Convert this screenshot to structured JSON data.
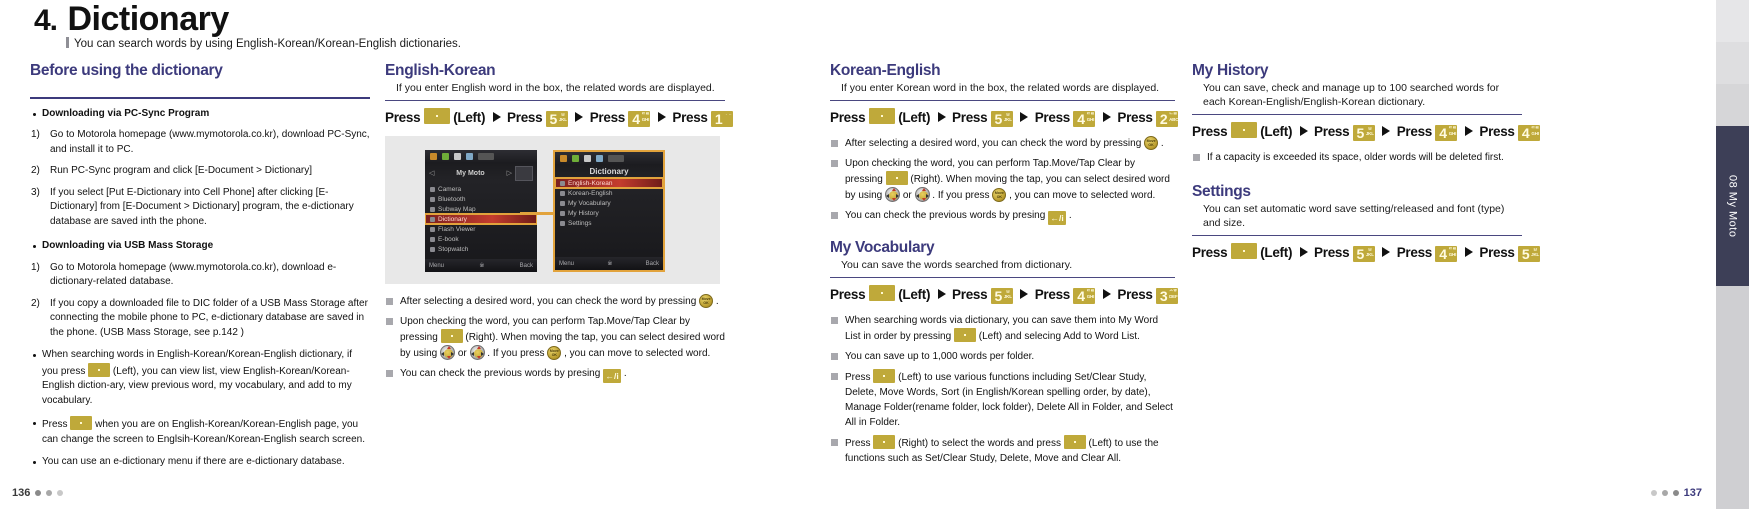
{
  "header": {
    "number": "4.",
    "title": "Dictionary",
    "subtitle": "You can search words by using English-Korean/Korean-English dictionaries."
  },
  "edge_tab": {
    "label": "08 My Moto"
  },
  "footer": {
    "page_left": "136",
    "page_right": "137"
  },
  "col1": {
    "title": "Before using the dictionary",
    "bullet_pcsync": "Downloading via PC-Sync Program",
    "steps_pcsync": [
      {
        "n": "1)",
        "text": "Go to Motorola homepage (www.mymotorola.co.kr), download PC-Sync, and install it to PC."
      },
      {
        "n": "2)",
        "text": "Run PC-Sync program and click [E-Document > Dictionary]"
      },
      {
        "n": "3)",
        "text": "If you select [Put E-Dictionary into Cell Phone] after clicking [E-Dictionary] from [E-Document > Dictionary] program, the e-dictionary database are saved inth the phone."
      }
    ],
    "bullet_usb": "Downloading via USB Mass Storage",
    "steps_usb": [
      {
        "n": "1)",
        "text": "Go to Motorola homepage (www.mymotorola.co.kr), download e-dictionary-related database."
      },
      {
        "n": "2)",
        "text": "If you copy a downloaded file to DIC folder of a USB Mass Storage after connecting the mobile phone to PC, e-dictionary database are saved in the phone. (USB Mass Storage, see p.142 )"
      }
    ],
    "notes": [
      {
        "pre": "When searching words in English-Korean/Korean-English dictionary, if you press",
        "post": "(Left), you can view list, view English-Korean/Korean-English diction-ary, view previous word, my vocabulary, and add to my vocabulary."
      },
      {
        "pre": "Press",
        "post": "when you are on English-Korean/Korean-English page, you can change the screen to Englsih-Korean/Korean-English search screen."
      },
      {
        "pre": "",
        "post": "You can use an e-dictionary menu if there are e-dictionary database."
      }
    ]
  },
  "col2": {
    "title": "English-Korean",
    "desc": "If you enter English word in the box, the related words are displayed.",
    "press": {
      "p1": "Press",
      "k1": "·",
      "left": "(Left)",
      "p2": "Press",
      "k2": "5",
      "k2sub": "ㅂ\nJKL",
      "p3": "Press",
      "k3": "4",
      "k3sub": "ᄃᄐ\nGHI",
      "p4": "Press",
      "k4": "1",
      "k4sub": "ᆞᆢ"
    },
    "figure": {
      "screen1": {
        "title": "My Moto",
        "items": [
          "Camera",
          "Bluetooth",
          "Subway Map",
          "Dictionary",
          "Flash Viewer",
          "E-book",
          "Stopwatch"
        ],
        "selected": "Dictionary",
        "soft_left": "Menu",
        "soft_mid": "※",
        "soft_right": "Back"
      },
      "screen2": {
        "title": "Dictionary",
        "items": [
          "English-Korean",
          "Korean-English",
          "My Vocabulary",
          "My History",
          "Settings"
        ],
        "selected": "English-Korean",
        "soft_left": "Menu",
        "soft_mid": "※",
        "soft_right": "Back"
      }
    },
    "notes": [
      {
        "a": "After selecting a desired word, you can check the word by pressing",
        "b": "."
      },
      {
        "a": "Upon checking the word, you can perform Tap.Move/Tap Clear by pressing",
        "b": "(Right). When moving the tap, you can select desired word by using",
        "c": "or",
        "d": ". If you press",
        "e": ", you can move to selected word."
      },
      {
        "a": "You  can check the previous words by presing",
        "b": "."
      }
    ],
    "keylabels": {
      "moveok": "Move\nOK",
      "back": "←/i"
    }
  },
  "col3": {
    "title": "Korean-English",
    "desc": "If you enter Korean word in the box, the related words are displayed.",
    "press": {
      "p1": "Press",
      "k1": "·",
      "left": "(Left)",
      "p2": "Press",
      "k2": "5",
      "k2sub": "ㅂ\nJKL",
      "p3": "Press",
      "k3": "4",
      "k3sub": "ᄃᄐ\nGHI",
      "p4": "Press",
      "k4": "2",
      "k4sub": "ᄂᄅ\nABC"
    },
    "notes": [
      {
        "a": "After selecting a desired word, you can check the word by pressing",
        "b": "."
      },
      {
        "a": "Upon checking the word, you can perform Tap.Move/Tap Clear by pressing",
        "b": "(Right). When moving the tap, you can select desired word by using",
        "c": "or",
        "d": ". If you press",
        "e": ", you can move to selected word."
      },
      {
        "a": "You  can check the previous words by presing",
        "b": "."
      }
    ],
    "vocab": {
      "title": "My Vocabulary",
      "desc": "You can save the words searched from dictionary.",
      "press": {
        "p1": "Press",
        "k1": "·",
        "left": "(Left)",
        "p2": "Press",
        "k2": "5",
        "k2sub": "ㅂ\nJKL",
        "p3": "Press",
        "k3": "4",
        "k3sub": "ᄃᄐ\nGHI",
        "p4": "Press",
        "k4": "3",
        "k4sub": "ᄉᄒ\nDEF"
      },
      "notes": [
        {
          "a": "When searching words via dictionary, you can save them into My Word List in order by pressing",
          "b": "(Left) and selecing Add to Word List."
        },
        {
          "a": "You can save up to 1,000 words per folder.",
          "b": ""
        },
        {
          "a": "Press",
          "b": "(Left) to use various functions including Set/Clear Study, Delete, Move Words, Sort (in English/Korean spelling order, by date), Manage Folder(rename folder, lock folder), Delete All in Folder, and Select All in Folder."
        },
        {
          "a": "Press",
          "b": "(Right) to select the words and press",
          "c": "(Left) to use the functions such as Set/Clear Study, Delete, Move and Clear All."
        }
      ]
    }
  },
  "col4": {
    "history": {
      "title": "My History",
      "desc": "You can save, check and manage up to 100 searched words for each Korean-English/English-Korean dictionary.",
      "press": {
        "p1": "Press",
        "k1": "·",
        "left": "(Left)",
        "p2": "Press",
        "k2": "5",
        "k2sub": "ㅂ\nJKL",
        "p3": "Press",
        "k3": "4",
        "k3sub": "ᄃᄐ\nGHI",
        "p4": "Press",
        "k4": "4",
        "k4sub": "ᄃᄐ\nGHI"
      },
      "note": "If a capacity is exceeded its space, older words will be deleted first."
    },
    "settings": {
      "title": "Settings",
      "desc": "You can set automatic word save setting/released and font (type) and size.",
      "press": {
        "p1": "Press",
        "k1": "·",
        "left": "(Left)",
        "p2": "Press",
        "k2": "5",
        "k2sub": "ㅂ\nJKL",
        "p3": "Press",
        "k3": "4",
        "k3sub": "ᄃᄐ\nGHI",
        "p4": "Press",
        "k4": "5",
        "k4sub": "ㅂ\nJKL"
      }
    }
  },
  "colors": {
    "accent": "#3c3a7c",
    "key": "#bfa93a",
    "highlight": "#e2a33c"
  }
}
